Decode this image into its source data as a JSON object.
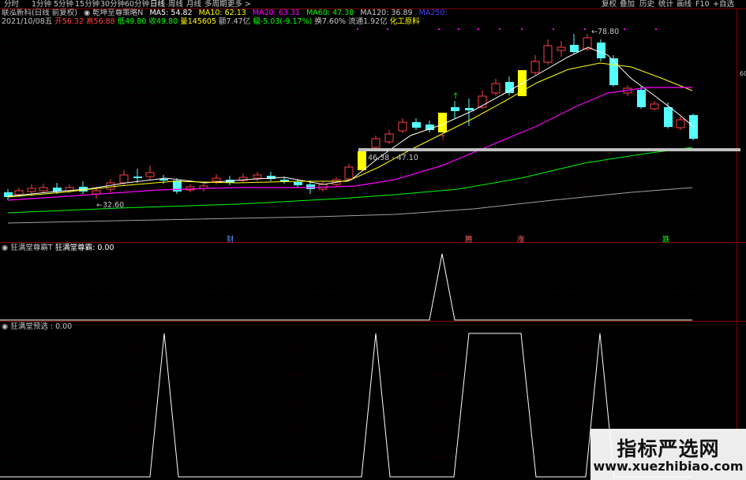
{
  "toolbar": {
    "periods": [
      "分时",
      "1分钟",
      "5分钟",
      "15分钟",
      "30分钟",
      "60分钟",
      "日线",
      "周线",
      "月线",
      "多周期",
      "更多 >"
    ],
    "active_period": "日线",
    "right_buttons": [
      "复权",
      "叠加",
      "历史",
      "统计",
      "画线",
      "F10",
      "+自选"
    ]
  },
  "header": {
    "stock": "联泓新科(日线 前复权)",
    "strategy": "乾坤至尊策略N",
    "ma5": "MA5: 54.82",
    "ma10": "MA10: 62.13",
    "ma20": "MA20: 63.31",
    "ma60": "MA60: 47.38",
    "ma120": "MA120: 36.89",
    "ma250": "MA250:"
  },
  "info": {
    "date": "2021/10/08五",
    "open": "开56.32",
    "high": "高56.88",
    "low": "低49.80",
    "close": "收49.80",
    "volume": "量145605",
    "amount": "额7.47亿",
    "change": "幅-5.03(-9.17%)",
    "turnover": "换7.60%",
    "float": "流通1.92亿",
    "sector": "化工原料"
  },
  "annotations": {
    "high": "78.80",
    "low": "32.60",
    "range": "46.38 - 47.10",
    "signals": [
      "财",
      "腾",
      "涨",
      "跌"
    ]
  },
  "axis": {
    "right_tick": "60"
  },
  "panel2": {
    "title": "狂满堂尊霸T",
    "value": "狂满堂尊霸: 0.00"
  },
  "panel3": {
    "title": "狂满堂预选 : 0.00"
  },
  "watermark": {
    "text": "指标严选网",
    "url": "www.xuezhibiao.com"
  },
  "colors": {
    "up": "#ff4040",
    "down": "#54ffff",
    "signal": "#ffff00",
    "ma5": "#ffffff",
    "ma10": "#ffff00",
    "ma20": "#ff00ff",
    "ma60": "#00ff00",
    "ma120": "#a0a0a0",
    "ma250": "#4040ff",
    "grid": "#8b0000"
  }
}
